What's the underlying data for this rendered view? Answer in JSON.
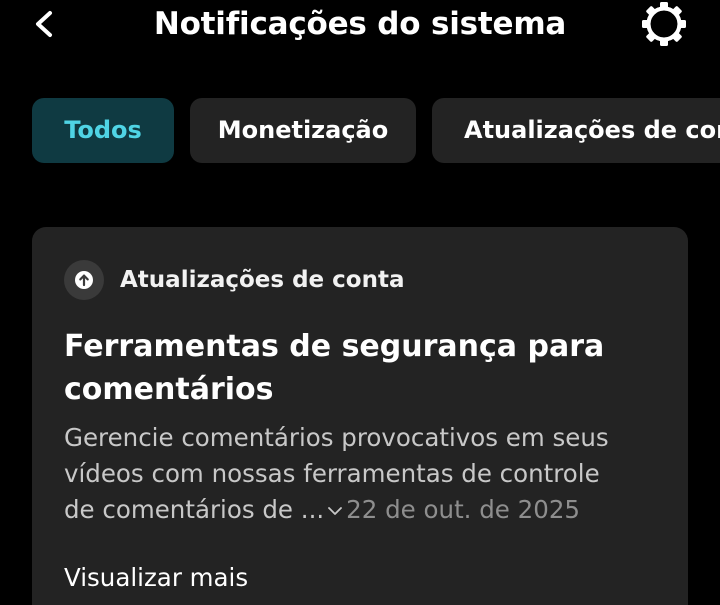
{
  "header": {
    "title": "Notificações do sistema",
    "back_icon": "chevron-left-icon",
    "settings_icon": "gear-icon"
  },
  "tabs": [
    {
      "label": "Todos",
      "active": true
    },
    {
      "label": "Monetização",
      "active": false
    },
    {
      "label": "Atualizações de conta",
      "active": false
    }
  ],
  "notification": {
    "category_icon": "arrow-up-circle-icon",
    "category": "Atualizações de conta",
    "title": "Ferramentas de segurança para comentários",
    "body_line_1": "Gerencie comentários provocativos em seus",
    "body_line_2": "vídeos com nossas ferramentas de controle",
    "body_line_3": "de comentários de ...",
    "expand_icon": "chevron-down-icon",
    "date": "22 de out. de 2025",
    "view_more": "Visualizar mais"
  },
  "colors": {
    "background": "#000000",
    "surface": "#232323",
    "active_tab_bg": "#0f3a42",
    "active_tab_text": "#4fd4e5",
    "muted_text": "#8e8e8e"
  }
}
